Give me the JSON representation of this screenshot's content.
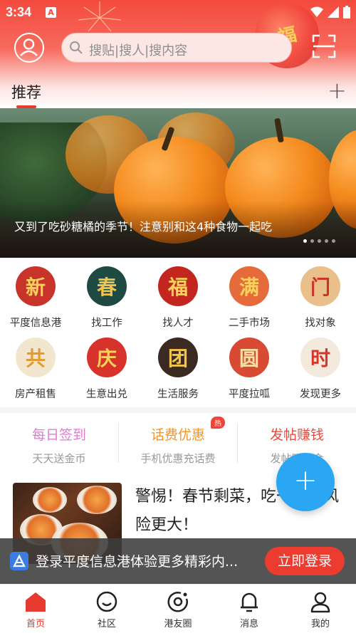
{
  "status_bar": {
    "time": "3:34",
    "app_badge": "A"
  },
  "header": {
    "search_placeholder": "搜贴|搜人|搜内容",
    "lantern_char": "福",
    "tab_label": "推荐",
    "add_tab_symbol": "+"
  },
  "banner": {
    "caption": "又到了吃砂糖橘的季节！注意别和这4种食物一起吃",
    "slide_count": 5,
    "active_slide": 1
  },
  "categories": [
    {
      "char": "新",
      "label": "平度信息港",
      "bg": "#c9342a",
      "fg": "#f6d25b"
    },
    {
      "char": "春",
      "label": "找工作",
      "bg": "#1f4a44",
      "fg": "#f2c44a"
    },
    {
      "char": "福",
      "label": "找人才",
      "bg": "#c3261f",
      "fg": "#f6d25b"
    },
    {
      "char": "满",
      "label": "二手市场",
      "bg": "#e66b3a",
      "fg": "#f8d35c"
    },
    {
      "char": "门",
      "label": "找对象",
      "bg": "#e9bf8a",
      "fg": "#c8352b"
    },
    {
      "char": "共",
      "label": "房产租售",
      "bg": "#f2e6cf",
      "fg": "#e49b2b"
    },
    {
      "char": "庆",
      "label": "生意出兑",
      "bg": "#d8332a",
      "fg": "#f6d25b"
    },
    {
      "char": "团",
      "label": "生活服务",
      "bg": "#3a2a22",
      "fg": "#f2c44a"
    },
    {
      "char": "圆",
      "label": "平度拉呱",
      "bg": "#d84a32",
      "fg": "#f6e0a2"
    },
    {
      "char": "时",
      "label": "发现更多",
      "bg": "#f3e9dc",
      "fg": "#d8352a"
    }
  ],
  "promos": [
    {
      "title": "每日签到",
      "sub": "天天送金币",
      "color": "#e07ad3"
    },
    {
      "title": "话费优惠",
      "sub": "手机优惠充话费",
      "color": "#f0952b",
      "tag": "热"
    },
    {
      "title": "发帖赚钱",
      "sub": "发帖赚赏金",
      "color": "#ea4a3b"
    }
  ],
  "article": {
    "title": "警惕！春节剩菜，吃时注意致癌风险更大！",
    "title_visible": "警惕！春节剩菜，吃一剩肉风险更大！"
  },
  "fab": {
    "symbol": "+"
  },
  "login_bar": {
    "text": "登录平度信息港体验更多精彩内...",
    "button": "立即登录"
  },
  "bottom_nav": [
    {
      "label": "首页",
      "icon": "home-icon",
      "active": true
    },
    {
      "label": "社区",
      "icon": "community-icon",
      "active": false
    },
    {
      "label": "港友圈",
      "icon": "circle-icon",
      "active": false
    },
    {
      "label": "消息",
      "icon": "bell-icon",
      "active": false
    },
    {
      "label": "我的",
      "icon": "profile-icon",
      "active": false
    }
  ],
  "colors": {
    "brand_red": "#e8392e",
    "fab_blue": "#2aa6f3"
  }
}
